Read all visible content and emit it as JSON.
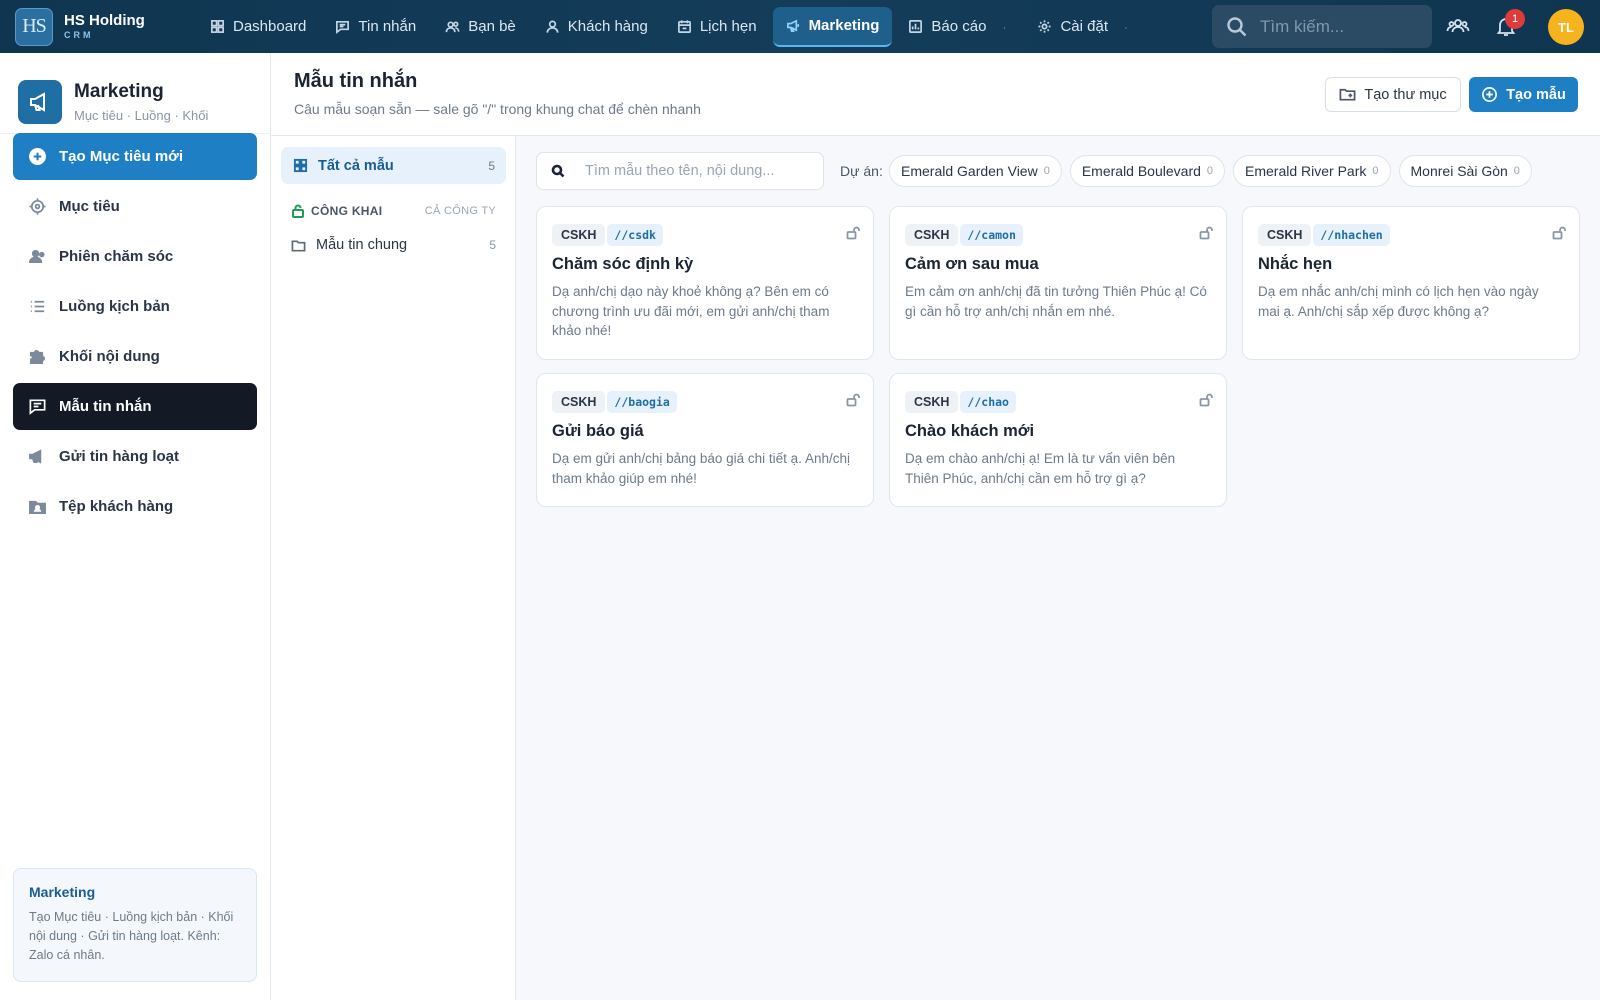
{
  "brand": {
    "logo": "HS",
    "name": "HS Holding",
    "sub": "CRM"
  },
  "nav": [
    {
      "label": "Dashboard",
      "icon": "grid-icon"
    },
    {
      "label": "Tin nhắn",
      "icon": "message-icon"
    },
    {
      "label": "Bạn bè",
      "icon": "friends-icon"
    },
    {
      "label": "Khách hàng",
      "icon": "user-icon"
    },
    {
      "label": "Lịch hẹn",
      "icon": "calendar-icon"
    },
    {
      "label": "Marketing",
      "icon": "megaphone-icon",
      "active": true
    },
    {
      "label": "Báo cáo",
      "icon": "chart-icon"
    },
    {
      "label": "Cài đặt",
      "icon": "gear-icon"
    }
  ],
  "top": {
    "search_placeholder": "Tìm kiếm...",
    "notif_count": "1",
    "avatar": "TL"
  },
  "sidebar": {
    "title": "Marketing",
    "subtitle": "Mục tiêu · Luồng · Khối",
    "items": [
      {
        "label": "Tạo Mục tiêu mới",
        "icon": "plus-circle-icon"
      },
      {
        "label": "Mục tiêu",
        "icon": "target-icon"
      },
      {
        "label": "Phiên chăm sóc",
        "icon": "users-icon"
      },
      {
        "label": "Luồng kịch bản",
        "icon": "list-icon"
      },
      {
        "label": "Khối nội dung",
        "icon": "puzzle-icon"
      },
      {
        "label": "Mẫu tin nhắn",
        "icon": "message-icon"
      },
      {
        "label": "Gửi tin hàng loạt",
        "icon": "megaphone-icon"
      },
      {
        "label": "Tệp khách hàng",
        "icon": "contacts-folder-icon"
      }
    ],
    "info_title": "Marketing",
    "info_body": "Tạo Mục tiêu · Luồng kịch bản · Khối nội dung · Gửi tin hàng loạt. Kênh: Zalo cá nhân."
  },
  "page": {
    "title": "Mẫu tin nhắn",
    "subtitle": "Câu mẫu soạn sẵn — sale gõ \"/\" trong khung chat để chèn nhanh",
    "btn_folder": "Tạo thư mục",
    "btn_create": "Tạo mẫu"
  },
  "folders": {
    "all_label": "Tất cả mẫu",
    "all_count": "5",
    "group_label": "CÔNG KHAI",
    "group_scope": "CẢ CÔNG TY",
    "items": [
      {
        "label": "Mẫu tin chung",
        "count": "5"
      }
    ]
  },
  "filter": {
    "search_placeholder": "Tìm mẫu theo tên, nội dung...",
    "project_label": "Dự án:",
    "projects": [
      {
        "name": "Emerald Garden View",
        "count": "0"
      },
      {
        "name": "Emerald Boulevard",
        "count": "0"
      },
      {
        "name": "Emerald River Park",
        "count": "0"
      },
      {
        "name": "Monrei Sài Gòn",
        "count": "0"
      }
    ]
  },
  "templates": [
    {
      "category": "CSKH",
      "shortcut": "//csdk",
      "title": "Chăm sóc định kỳ",
      "body": "Dạ anh/chị dạo này khoẻ không ạ? Bên em có chương trình ưu đãi mới, em gửi anh/chị tham khảo nhé!"
    },
    {
      "category": "CSKH",
      "shortcut": "//camon",
      "title": "Cảm ơn sau mua",
      "body": "Em cảm ơn anh/chị đã tin tưởng Thiên Phúc ạ! Có gì cần hỗ trợ anh/chị nhắn em nhé."
    },
    {
      "category": "CSKH",
      "shortcut": "//nhachen",
      "title": "Nhắc hẹn",
      "body": "Dạ em nhắc anh/chị mình có lịch hẹn vào ngày mai ạ. Anh/chị sắp xếp được không ạ?"
    },
    {
      "category": "CSKH",
      "shortcut": "//baogia",
      "title": "Gửi báo giá",
      "body": "Dạ em gửi anh/chị bảng báo giá chi tiết ạ. Anh/chị tham khảo giúp em nhé!"
    },
    {
      "category": "CSKH",
      "shortcut": "//chao",
      "title": "Chào khách mới",
      "body": "Dạ em chào anh/chị ạ! Em là tư vấn viên bên Thiên Phúc, anh/chị cần em hỗ trợ gì ạ?"
    }
  ],
  "colors": {
    "topbar": "#0f3550",
    "primary": "#1f7fc4",
    "active_dark": "#131a25",
    "badge": "#e03b3b",
    "avatar": "#f5b41e"
  }
}
